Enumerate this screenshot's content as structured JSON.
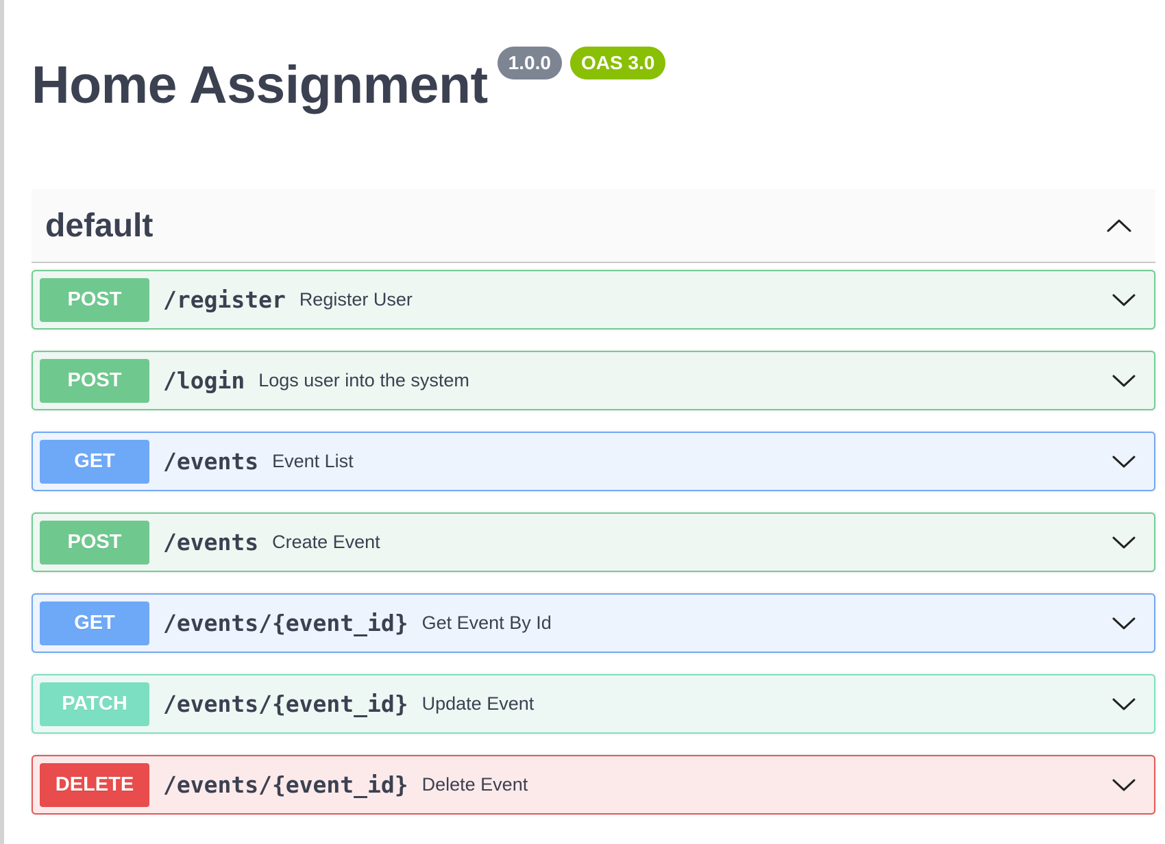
{
  "info": {
    "title": "Home Assignment",
    "version": "1.0.0",
    "oas": "OAS 3.0"
  },
  "tag": {
    "name": "default",
    "expanded": true,
    "toggle_icon": "chevron-up-icon"
  },
  "operations": [
    {
      "method": "POST",
      "path": "/register",
      "summary": "Register User"
    },
    {
      "method": "POST",
      "path": "/login",
      "summary": "Logs user into the system"
    },
    {
      "method": "GET",
      "path": "/events",
      "summary": "Event List"
    },
    {
      "method": "POST",
      "path": "/events",
      "summary": "Create Event"
    },
    {
      "method": "GET",
      "path": "/events/{event_id}",
      "summary": "Get Event By Id"
    },
    {
      "method": "PATCH",
      "path": "/events/{event_id}",
      "summary": "Update Event"
    },
    {
      "method": "DELETE",
      "path": "/events/{event_id}",
      "summary": "Delete Event"
    }
  ],
  "colors": {
    "post": "#49cc90",
    "get": "#61affe",
    "patch": "#50e3c2",
    "delete": "#f93e3e",
    "version_badge": "#7d8492",
    "oas_badge": "#89bf04"
  }
}
